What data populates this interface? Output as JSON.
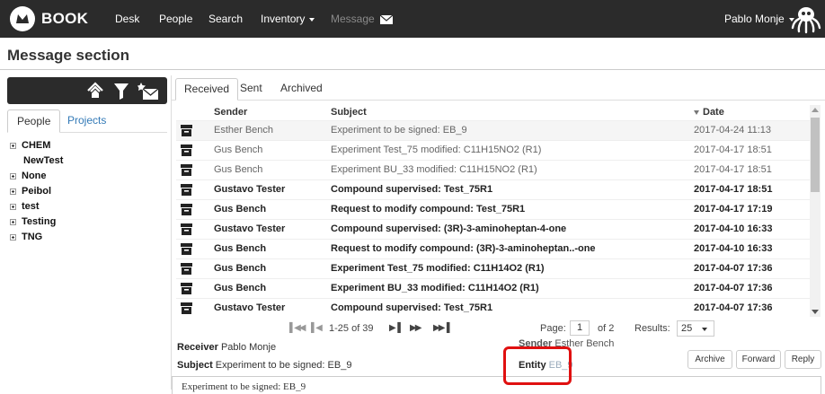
{
  "navbar": {
    "brand": "BOOK",
    "items": [
      "Desk",
      "People",
      "Search",
      "Inventory",
      "Message"
    ],
    "user": "Pablo Monje"
  },
  "page_title": "Message section",
  "left_panel": {
    "tabs": [
      "People",
      "Projects"
    ],
    "tree": [
      {
        "label": "CHEM",
        "expandable": true
      },
      {
        "label": "NewTest",
        "expandable": false
      },
      {
        "label": "None",
        "expandable": true
      },
      {
        "label": "Peibol",
        "expandable": true
      },
      {
        "label": "test",
        "expandable": true
      },
      {
        "label": "Testing",
        "expandable": true
      },
      {
        "label": "TNG",
        "expandable": true
      }
    ]
  },
  "tabs": [
    "Received",
    "Sent",
    "Archived"
  ],
  "table": {
    "headers": {
      "sender": "Sender",
      "subject": "Subject",
      "date": "Date"
    },
    "rows": [
      {
        "sender": "Esther Bench",
        "subject": "Experiment to be signed: EB_9",
        "date": "2017-04-24 11:13",
        "read": true
      },
      {
        "sender": "Gus Bench",
        "subject": "Experiment Test_75 modified: C11H15NO2 (R1)",
        "date": "2017-04-17 18:51",
        "read": true
      },
      {
        "sender": "Gus Bench",
        "subject": "Experiment BU_33 modified: C11H15NO2 (R1)",
        "date": "2017-04-17 18:51",
        "read": true
      },
      {
        "sender": "Gustavo Tester",
        "subject": "Compound supervised: Test_75R1",
        "date": "2017-04-17 18:51",
        "read": false
      },
      {
        "sender": "Gus Bench",
        "subject": "Request to modify compound: Test_75R1",
        "date": "2017-04-17 17:19",
        "read": false
      },
      {
        "sender": "Gustavo Tester",
        "subject": "Compound supervised: (3R)-3-aminoheptan-4-one",
        "date": "2017-04-10 16:33",
        "read": false
      },
      {
        "sender": "Gus Bench",
        "subject": "Request to modify compound: (3R)-3-aminoheptan..-one",
        "date": "2017-04-10 16:33",
        "read": false
      },
      {
        "sender": "Gus Bench",
        "subject": "Experiment Test_75 modified: C11H14O2 (R1)",
        "date": "2017-04-07 17:36",
        "read": false
      },
      {
        "sender": "Gus Bench",
        "subject": "Experiment BU_33 modified: C11H14O2 (R1)",
        "date": "2017-04-07 17:36",
        "read": false
      },
      {
        "sender": "Gustavo Tester",
        "subject": "Compound supervised: Test_75R1",
        "date": "2017-04-07 17:36",
        "read": false
      }
    ]
  },
  "pager": {
    "range": "1-25 of 39",
    "page_label": "Page:",
    "page_value": "1",
    "of_pages": "of 2",
    "results_label": "Results:",
    "results_value": "25"
  },
  "detail": {
    "receiver_label": "Receiver",
    "receiver": "Pablo Monje",
    "sender_label": "Sender",
    "sender": "Esther Bench",
    "subject_label": "Subject",
    "subject": "Experiment to be signed: EB_9",
    "entity_label": "Entity",
    "entity": "EB_9",
    "body": "Experiment to be signed: EB_9"
  },
  "actions": {
    "archive": "Archive",
    "forward": "Forward",
    "reply": "Reply"
  },
  "colors": {
    "navbar": "#2b2b2b",
    "highlight": "#e01010",
    "link": "#337ab7"
  }
}
